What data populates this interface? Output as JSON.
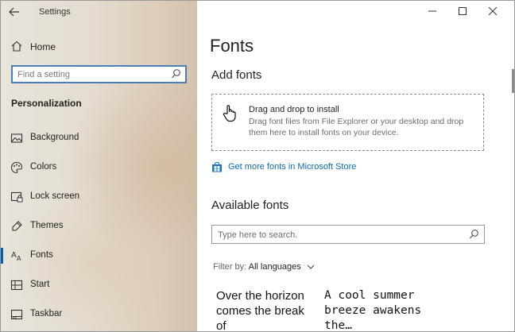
{
  "app": {
    "title": "Settings"
  },
  "sidebar": {
    "home_label": "Home",
    "search_placeholder": "Find a setting",
    "section_title": "Personalization",
    "items": [
      {
        "label": "Background",
        "icon": "background-icon"
      },
      {
        "label": "Colors",
        "icon": "colors-icon"
      },
      {
        "label": "Lock screen",
        "icon": "lock-screen-icon"
      },
      {
        "label": "Themes",
        "icon": "themes-icon"
      },
      {
        "label": "Fonts",
        "icon": "fonts-icon",
        "active": true
      },
      {
        "label": "Start",
        "icon": "start-icon"
      },
      {
        "label": "Taskbar",
        "icon": "taskbar-icon"
      }
    ]
  },
  "main": {
    "title": "Fonts",
    "add_fonts": {
      "heading": "Add fonts",
      "drop_title": "Drag and drop to install",
      "drop_desc": "Drag font files from File Explorer or your desktop and drop them here to install fonts on your device."
    },
    "store_link": "Get more fonts in Microsoft Store",
    "available": {
      "heading": "Available fonts",
      "search_placeholder": "Type here to search.",
      "filter_label": "Filter by:",
      "filter_value": "All languages",
      "previews": [
        "Over the horizon comes the break of",
        "A cool summer breeze awakens the…"
      ]
    }
  },
  "colors": {
    "accent": "#0063b1",
    "link": "#0a6ab0"
  }
}
